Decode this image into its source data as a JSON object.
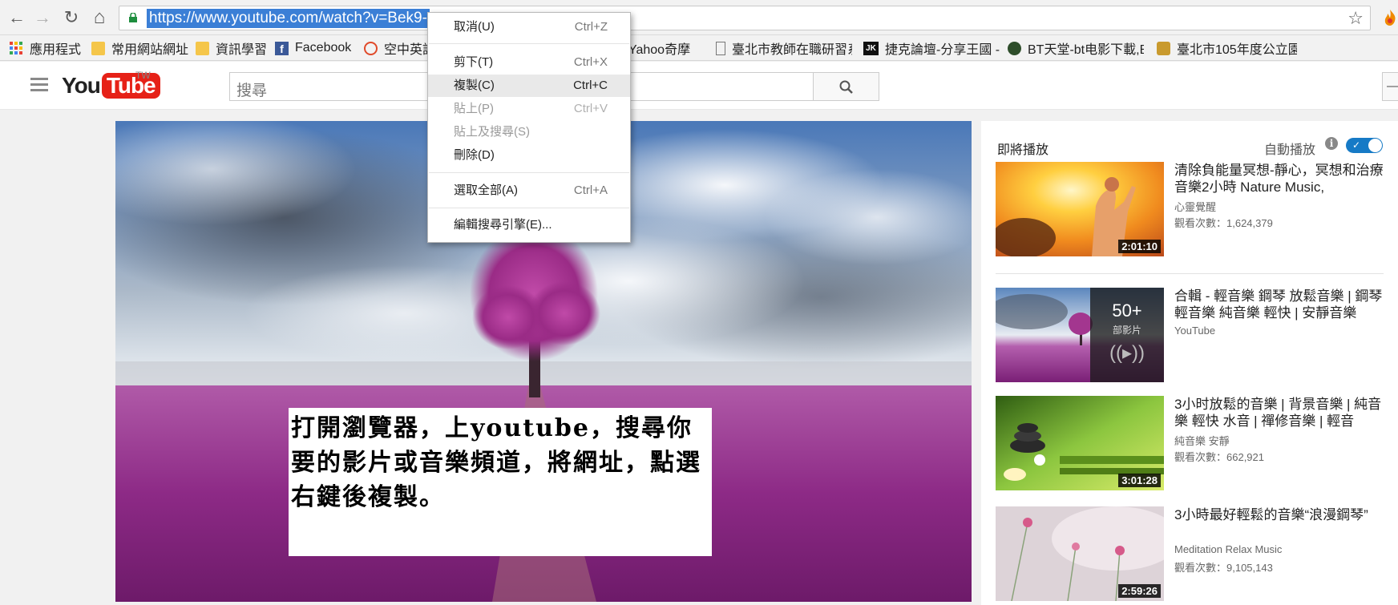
{
  "browser": {
    "url_visible": "https://www.youtube.com/watch?v=Bek9-",
    "nav": {
      "back": "←",
      "forward": "→",
      "reload": "↻",
      "home": "⌂"
    },
    "bookmark_star": "☆"
  },
  "bookmarks": [
    {
      "label": "應用程式",
      "icon": "apps-grid-icon"
    },
    {
      "label": "常用網站網址",
      "icon": "folder-icon"
    },
    {
      "label": "資訊學習",
      "icon": "folder-icon"
    },
    {
      "label": "Facebook",
      "icon": "facebook-icon"
    },
    {
      "label": "空中英語",
      "icon": "site-icon"
    },
    {
      "label": "Yahoo奇摩",
      "icon": "yahoo-icon"
    },
    {
      "label": "臺北市教師在職研習系",
      "icon": "page-icon"
    },
    {
      "label": "捷克論壇-分享王國 -",
      "icon": "jk-icon"
    },
    {
      "label": "BT天堂-bt电影下載,B",
      "icon": "bt-icon"
    },
    {
      "label": "臺北市105年度公立園",
      "icon": "site-icon"
    }
  ],
  "youtube": {
    "logo_you": "You",
    "logo_tube": "Tube",
    "region": "TW",
    "search_placeholder": "搜尋"
  },
  "context_menu": {
    "items": [
      {
        "label": "取消(U)",
        "shortcut": "Ctrl+Z",
        "state": "normal"
      },
      {
        "label": "剪下(T)",
        "shortcut": "Ctrl+X",
        "state": "normal"
      },
      {
        "label": "複製(C)",
        "shortcut": "Ctrl+C",
        "state": "highlighted"
      },
      {
        "label": "貼上(P)",
        "shortcut": "Ctrl+V",
        "state": "disabled"
      },
      {
        "label": "貼上及搜尋(S)",
        "shortcut": "",
        "state": "disabled"
      },
      {
        "label": "刪除(D)",
        "shortcut": "",
        "state": "normal"
      },
      {
        "label": "選取全部(A)",
        "shortcut": "Ctrl+A",
        "state": "normal"
      },
      {
        "label": "編輯搜尋引擎(E)...",
        "shortcut": "",
        "state": "normal"
      }
    ]
  },
  "video": {
    "caption": "打開瀏覽器，上youtube，搜尋你要的影片或音樂頻道，將網址，點選右鍵後複製。"
  },
  "sidebar": {
    "up_next": "即將播放",
    "autoplay": "自動播放",
    "autoplay_on": true,
    "cards": [
      {
        "title": "清除負能量冥想-靜心，冥想和治療音樂2小時 Nature Music,",
        "channel": "心靈覺醒",
        "views": "觀看次數：1,624,379",
        "duration": "2:01:10"
      },
      {
        "title": "合輯 - 輕音樂 鋼琴 放鬆音樂 | 鋼琴輕音樂 純音樂 輕快 | 安靜音樂",
        "channel": "YouTube",
        "views": "",
        "duration": "",
        "playlist_count": "50+",
        "playlist_label": "部影片"
      },
      {
        "title": "3小时放鬆的音樂 | 背景音樂 | 純音樂 輕快 水音 | 禪修音樂 | 輕音",
        "channel": "純音樂 安靜",
        "views": "觀看次數：662,921",
        "duration": "3:01:28"
      },
      {
        "title": "3小時最好輕鬆的音樂“浪漫鋼琴”",
        "channel": "Meditation Relax Music",
        "views": "觀看次數：9,105,143",
        "duration": "2:59:26"
      }
    ]
  },
  "colors": {
    "youtube_red": "#e62117",
    "selection_blue": "#3b7fd6",
    "toggle_blue": "#167ac6"
  }
}
